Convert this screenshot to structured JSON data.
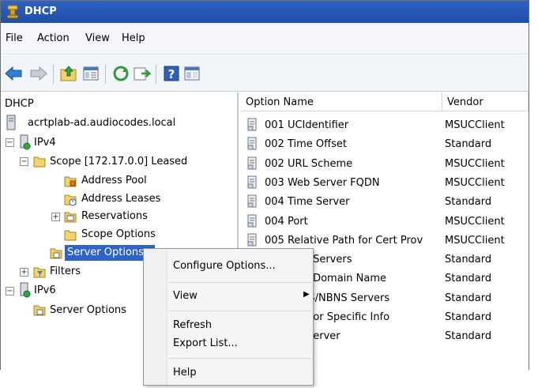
{
  "window": {
    "title": "DHCP"
  },
  "menu": [
    "File",
    "Action",
    "View",
    "Help"
  ],
  "toolbar": {
    "icons": [
      "back-icon",
      "forward-icon",
      "up-folder-icon",
      "show-hide-tree-icon",
      "refresh-icon",
      "export-list-icon",
      "help-icon",
      "properties-icon"
    ]
  },
  "tree": {
    "root": "DHCP",
    "server": "acrtplab-ad.audiocodes.local",
    "ipv4": "IPv4",
    "scope": "Scope [172.17.0.0] Leased",
    "address_pool": "Address Pool",
    "address_leases": "Address Leases",
    "reservations": "Reservations",
    "scope_options": "Scope Options",
    "server_options": "Server Options",
    "filters": "Filters",
    "ipv6": "IPv6",
    "ipv6_server_options": "Server Options"
  },
  "list": {
    "columns": [
      "Option Name",
      "Vendor"
    ],
    "rows": [
      {
        "name": "001 UCIdentifier",
        "vendor": "MSUCClient"
      },
      {
        "name": "002 Time Offset",
        "vendor": "Standard"
      },
      {
        "name": "002 URL Scheme",
        "vendor": "MSUCClient"
      },
      {
        "name": "003 Web Server FQDN",
        "vendor": "MSUCClient"
      },
      {
        "name": "004 Time Server",
        "vendor": "Standard"
      },
      {
        "name": "004 Port",
        "vendor": "MSUCClient"
      },
      {
        "name": "005 Relative Path for Cert Prov",
        "vendor": "MSUCClient"
      },
      {
        "name": "006 DNS Servers",
        "vendor": "Standard"
      },
      {
        "name": "015 DNS Domain Name",
        "vendor": "Standard"
      },
      {
        "name": "044 WINS/NBNS Servers",
        "vendor": "Standard"
      },
      {
        "name": "043 Vendor Specific Info",
        "vendor": "Standard"
      },
      {
        "name": "120 SIP Server",
        "vendor": "Standard"
      }
    ]
  },
  "context_menu": {
    "configure": "Configure Options...",
    "view": "View",
    "refresh": "Refresh",
    "export": "Export List...",
    "help": "Help"
  },
  "colors": {
    "selection": "#2f63c4",
    "highlight": "#f2f400",
    "title_bar": "#1d4fa8"
  }
}
